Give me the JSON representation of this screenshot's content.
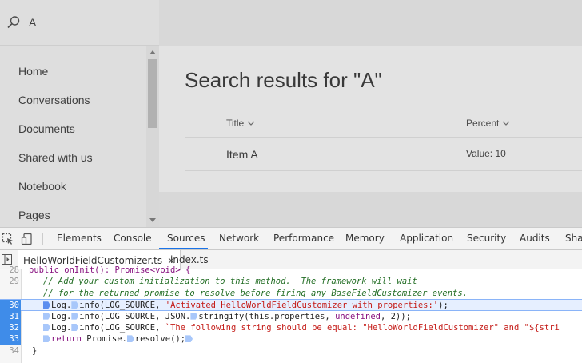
{
  "search": {
    "value": "A"
  },
  "sidebar": {
    "items": [
      {
        "label": "Home"
      },
      {
        "label": "Conversations"
      },
      {
        "label": "Documents"
      },
      {
        "label": "Shared with us"
      },
      {
        "label": "Notebook"
      },
      {
        "label": "Pages"
      }
    ]
  },
  "content": {
    "title": "Search results for \"A\"",
    "columns": [
      {
        "label": "Title"
      },
      {
        "label": "Percent"
      }
    ],
    "rows": [
      {
        "title": "Item A",
        "percent": "Value: 10"
      }
    ]
  },
  "devtools": {
    "tabs": [
      "Elements",
      "Console",
      "Sources",
      "Network",
      "Performance",
      "Memory",
      "Application",
      "Security",
      "Audits",
      "Sha"
    ],
    "active_tab": "Sources",
    "files": [
      {
        "name": "HelloWorldFieldCustomizer.ts",
        "close": "×"
      },
      {
        "name": "index.ts"
      }
    ],
    "code": {
      "execution_line": "30",
      "lines": [
        {
          "num": "28",
          "text": "public onInit(): Promise<void> {"
        },
        {
          "num": "29",
          "text": "// Add your custom initialization to this method.  The framework will wait"
        },
        {
          "num": "",
          "text": "// for the returned promise to resolve before firing any BaseFieldCustomizer events."
        },
        {
          "num": "30",
          "pre": "Log.",
          "fn": "info(LOG_SOURCE, ",
          "str": "'Activated HelloWorldFieldCustomizer with properties:'",
          "post": ");"
        },
        {
          "num": "31",
          "pre": "Log.",
          "fn": "info(LOG_SOURCE, JSON.",
          "fn2": "stringify(this.properties, ",
          "kw": "undefined",
          "num2": ", 2));"
        },
        {
          "num": "32",
          "pre": "Log.",
          "fn": "info(LOG_SOURCE, ",
          "str": "`The following string should be equal: \"HelloWorldFieldCustomizer\" and \"${stri"
        },
        {
          "num": "33",
          "kw": "return",
          "post": " Promise.",
          "fn": "resolve();"
        },
        {
          "num": "34",
          "text": "}"
        }
      ]
    }
  },
  "colors": {
    "accent": "#1a73e8",
    "breakpoint": "#3f8ce9",
    "comment": "#236e25",
    "string": "#c41a16"
  }
}
